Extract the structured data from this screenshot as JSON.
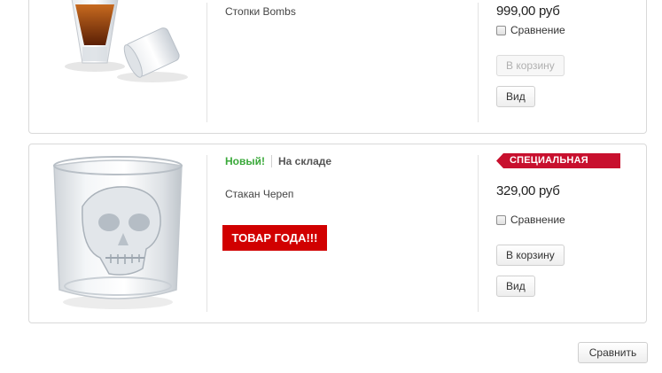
{
  "products": [
    {
      "name": "Стопки Bombs",
      "price": "999,00 руб",
      "compare_label": "Сравнение",
      "cart_label": "В корзину",
      "view_label": "Вид"
    },
    {
      "badge_new": "Новый!",
      "availability": "На складе",
      "special_label": "СПЕЦИАЛЬНАЯ",
      "name": "Стакан Череп",
      "promo_label": "ТОВАР ГОДА!!!",
      "price": "329,00 руб",
      "compare_label": "Сравнение",
      "cart_label": "В корзину",
      "view_label": "Вид"
    }
  ],
  "compare_button": "Сравнить",
  "colors": {
    "special_bg": "#c8102e",
    "promo_bg": "#d10000",
    "new_text": "#3aa93a"
  }
}
